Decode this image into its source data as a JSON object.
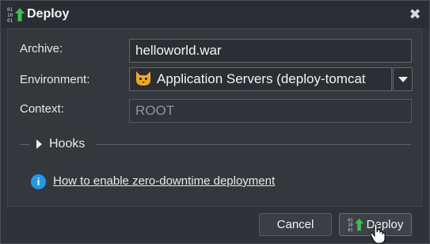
{
  "dialog": {
    "title": "Deploy",
    "close_glyph": "✖"
  },
  "form": {
    "archive_label": "Archive:",
    "archive_value": "helloworld.war",
    "environment_label": "Environment:",
    "environment_value": "Application Servers (deploy-tomcat",
    "context_label": "Context:",
    "context_value": "ROOT"
  },
  "hooks": {
    "label": "Hooks"
  },
  "info": {
    "icon_glyph": "i",
    "link_text": "How to enable zero-downtime deployment"
  },
  "buttons": {
    "cancel_label": "Cancel",
    "deploy_label": "Deploy"
  },
  "colors": {
    "accent_info": "#1e9be8",
    "deploy_arrow": "#3cc24a"
  }
}
